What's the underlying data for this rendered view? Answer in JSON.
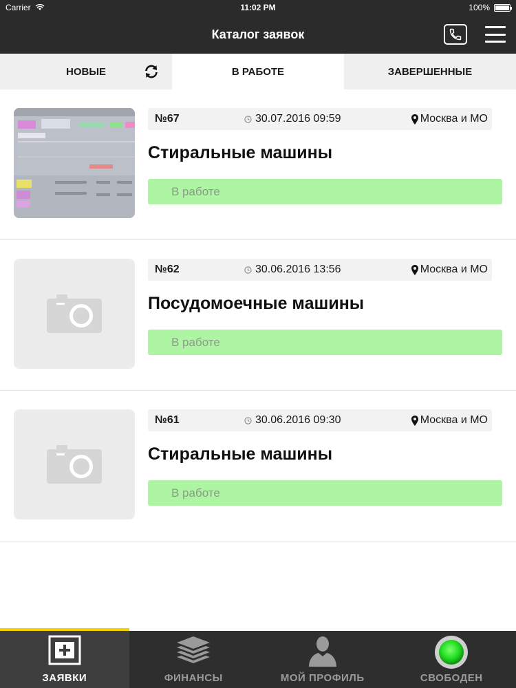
{
  "status_bar": {
    "carrier": "Carrier",
    "time": "11:02 PM",
    "battery": "100%",
    "battery_level": 1.0
  },
  "header": {
    "title": "Каталог заявок"
  },
  "tabs": [
    {
      "label": "НОВЫЕ"
    },
    {
      "label": "В РАБОТЕ"
    },
    {
      "label": "ЗАВЕРШЕННЫЕ"
    }
  ],
  "orders": [
    {
      "number": "№67",
      "datetime": "30.07.2016 09:59",
      "location": "Москва и МО",
      "title": "Стиральные машины",
      "status": "В работе"
    },
    {
      "number": "№62",
      "datetime": "30.06.2016 13:56",
      "location": "Москва и МО",
      "title": "Посудомоечные машины",
      "status": "В работе"
    },
    {
      "number": "№61",
      "datetime": "30.06.2016 09:30",
      "location": "Москва и МО",
      "title": "Стиральные машины",
      "status": "В работе"
    }
  ],
  "bottom_nav": [
    {
      "label": "ЗАЯВКИ",
      "icon": "add-box-icon"
    },
    {
      "label": "ФИНАНСЫ",
      "icon": "layers-icon"
    },
    {
      "label": "МОЙ ПРОФИЛЬ",
      "icon": "person-icon"
    },
    {
      "label": "СВОБОДЕН",
      "icon": "status-light-icon"
    }
  ],
  "colors": {
    "header_bg": "#2b2b2b",
    "status_in_work": "#aef5a3",
    "active_tab_accent": "#f5d100",
    "online_indicator": "#22dd22"
  }
}
